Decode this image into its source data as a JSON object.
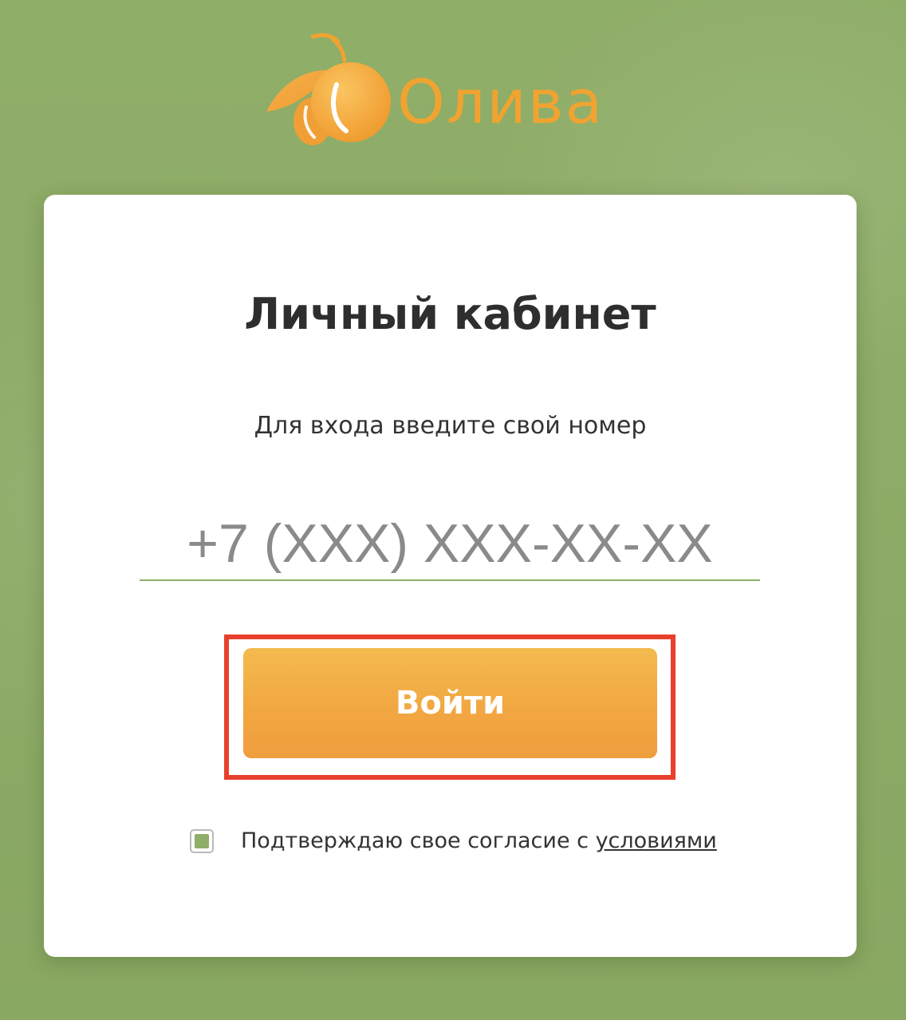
{
  "brand": {
    "name": "Олива",
    "accent_color": "#f0a331",
    "green_color": "#8fae68"
  },
  "login": {
    "title": "Личный кабинет",
    "subtitle": "Для входа введите свой номер",
    "phone_placeholder": "+7 (XXX) XXX-XX-XX",
    "phone_value": "",
    "submit_label": "Войти",
    "submit_highlighted": true,
    "highlight_color": "#e8402c"
  },
  "consent": {
    "checked": true,
    "text": "Подтверждаю свое согласие с ",
    "link_text": "условиями"
  }
}
